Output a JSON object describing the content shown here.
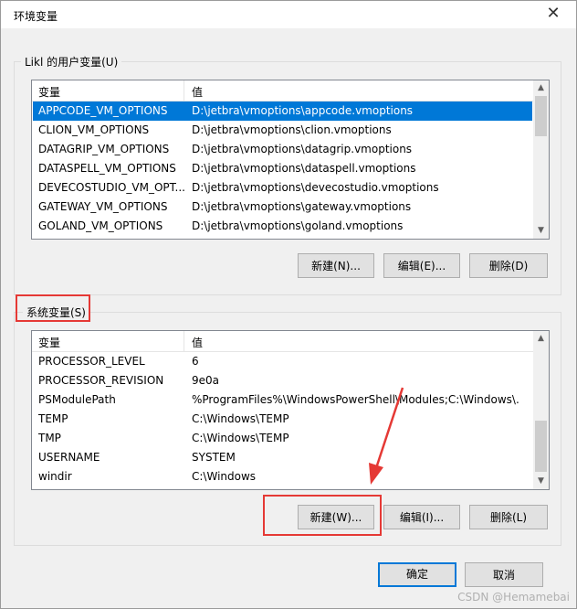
{
  "window": {
    "title": "环境变量",
    "close_icon": "✕"
  },
  "user_vars": {
    "group_label": "Likl 的用户变量(U)",
    "headers": [
      "变量",
      "值"
    ],
    "rows": [
      {
        "name": "APPCODE_VM_OPTIONS",
        "value": "D:\\jetbra\\vmoptions\\appcode.vmoptions"
      },
      {
        "name": "CLION_VM_OPTIONS",
        "value": "D:\\jetbra\\vmoptions\\clion.vmoptions"
      },
      {
        "name": "DATAGRIP_VM_OPTIONS",
        "value": "D:\\jetbra\\vmoptions\\datagrip.vmoptions"
      },
      {
        "name": "DATASPELL_VM_OPTIONS",
        "value": "D:\\jetbra\\vmoptions\\dataspell.vmoptions"
      },
      {
        "name": "DEVECOSTUDIO_VM_OPT...",
        "value": "D:\\jetbra\\vmoptions\\devecostudio.vmoptions"
      },
      {
        "name": "GATEWAY_VM_OPTIONS",
        "value": "D:\\jetbra\\vmoptions\\gateway.vmoptions"
      },
      {
        "name": "GOLAND_VM_OPTIONS",
        "value": "D:\\jetbra\\vmoptions\\goland.vmoptions"
      }
    ],
    "buttons": {
      "new": "新建(N)...",
      "edit": "编辑(E)...",
      "delete": "删除(D)"
    }
  },
  "system_vars": {
    "group_label": "系统变量(S)",
    "headers": [
      "变量",
      "值"
    ],
    "rows": [
      {
        "name": "PROCESSOR_LEVEL",
        "value": "6"
      },
      {
        "name": "PROCESSOR_REVISION",
        "value": "9e0a"
      },
      {
        "name": "PSModulePath",
        "value": "%ProgramFiles%\\WindowsPowerShell\\Modules;C:\\Windows\\..."
      },
      {
        "name": "TEMP",
        "value": "C:\\Windows\\TEMP"
      },
      {
        "name": "TMP",
        "value": "C:\\Windows\\TEMP"
      },
      {
        "name": "USERNAME",
        "value": "SYSTEM"
      },
      {
        "name": "windir",
        "value": "C:\\Windows"
      }
    ],
    "buttons": {
      "new": "新建(W)...",
      "edit": "编辑(I)...",
      "delete": "删除(L)"
    }
  },
  "footer": {
    "ok": "确定",
    "cancel": "取消"
  },
  "watermark": "CSDN @Hemamebai",
  "scroll_arrows": {
    "up": "▲",
    "down": "▼"
  },
  "colors": {
    "selection": "#0078d7",
    "annotation": "#e53935"
  }
}
